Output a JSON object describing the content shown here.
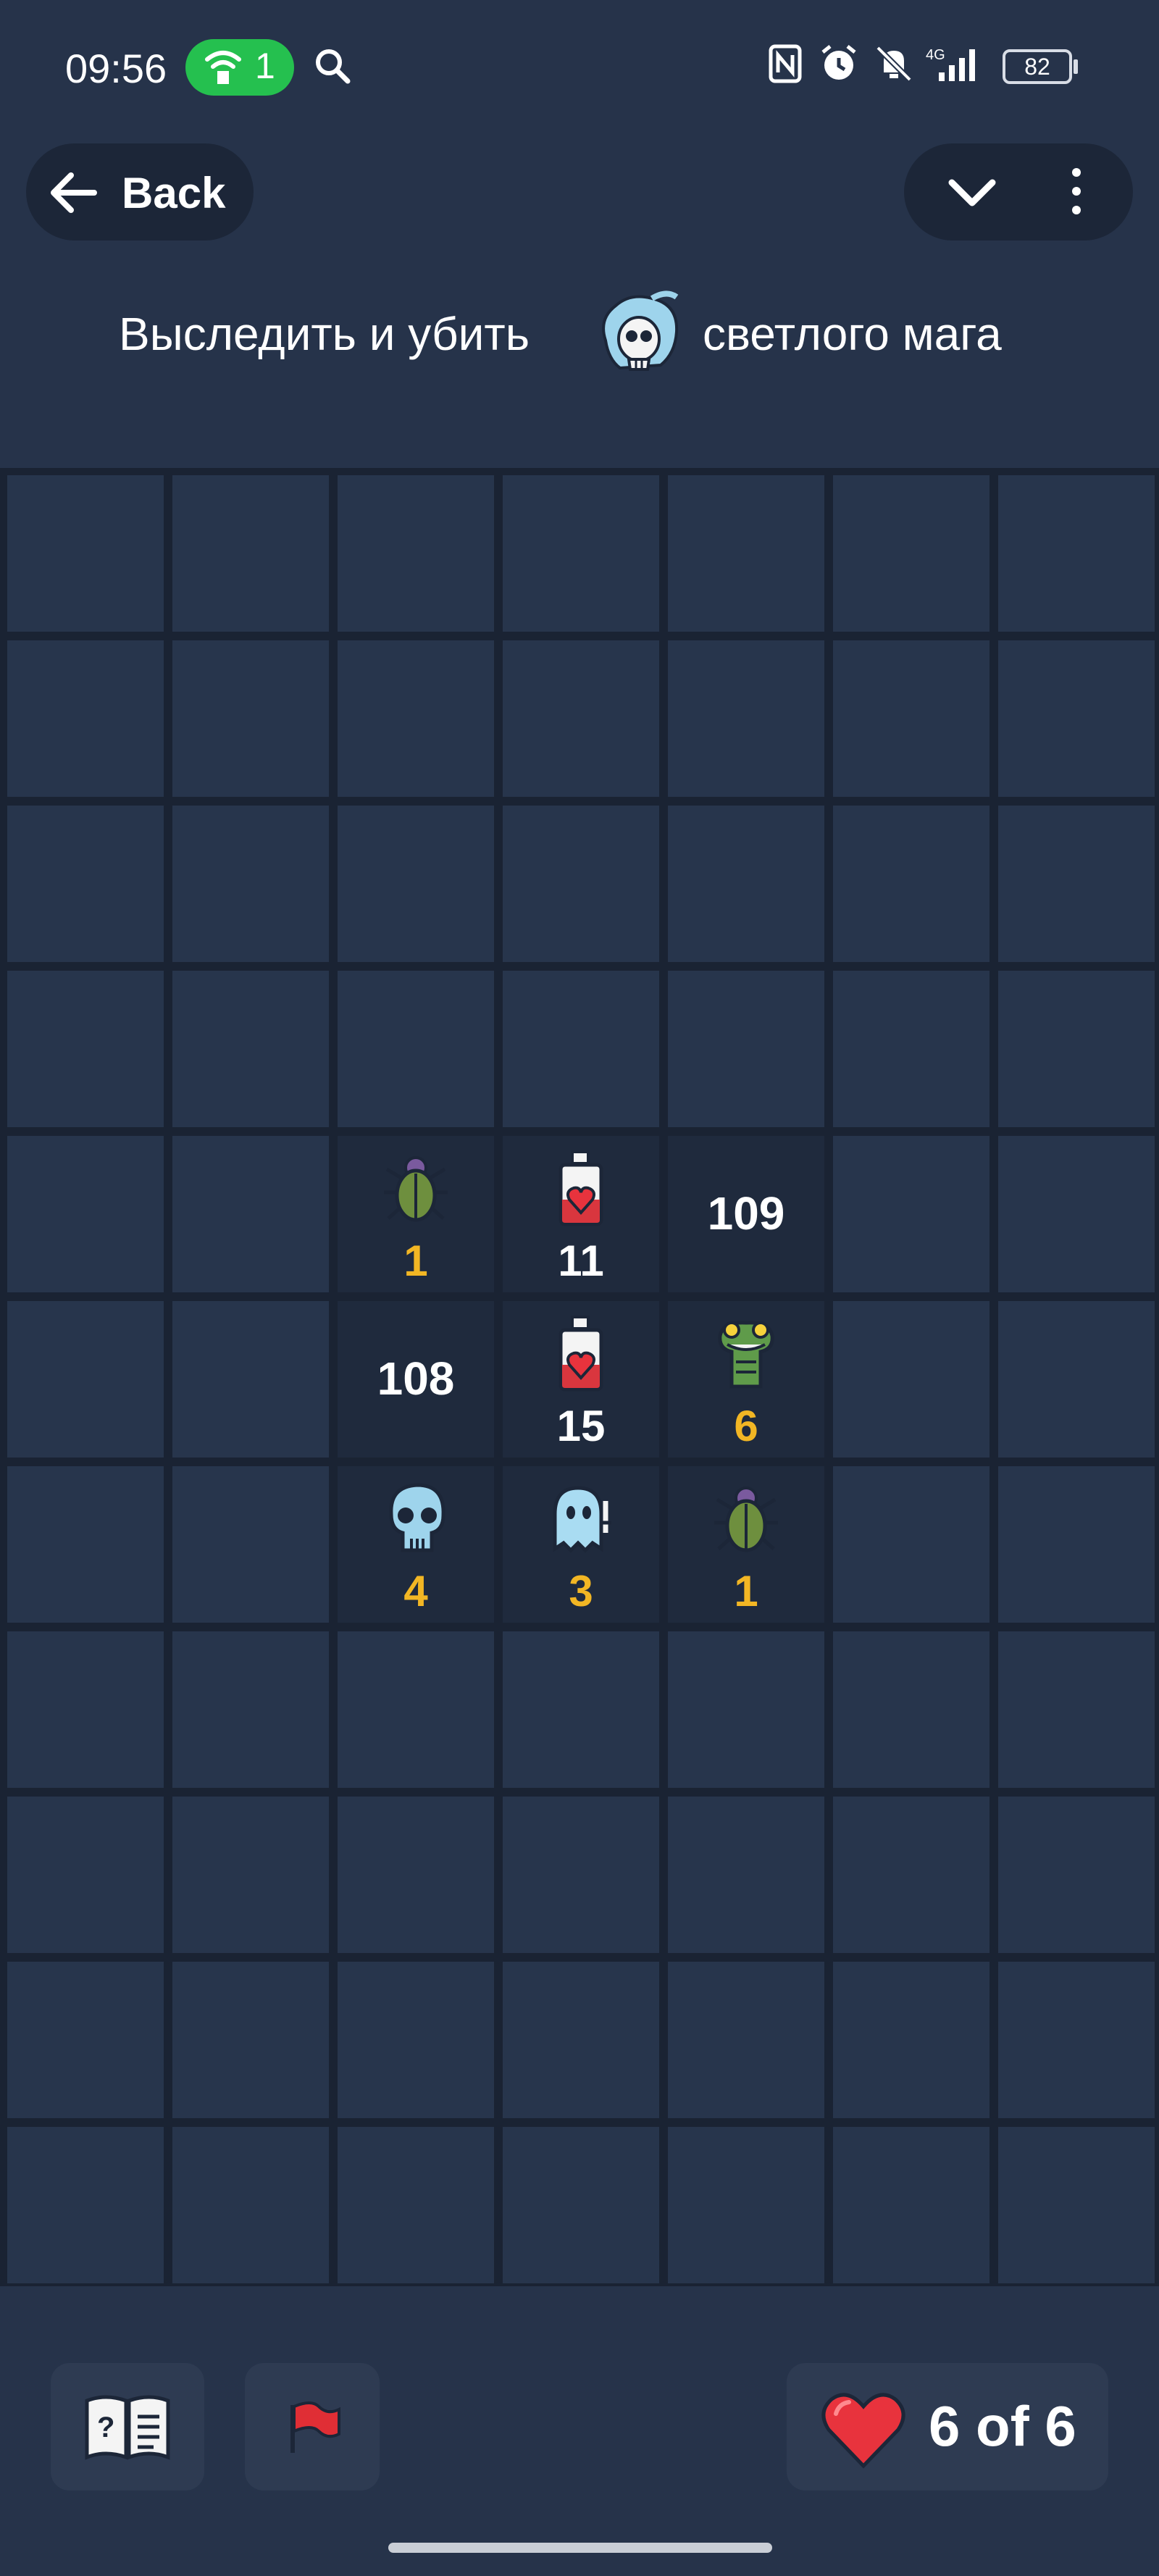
{
  "status_bar": {
    "time": "09:56",
    "hotspot_count": "1",
    "battery_level": "82"
  },
  "header": {
    "back_label": "Back"
  },
  "quest": {
    "text_before": "Выследить и убить",
    "text_after": "светлого мага",
    "target_icon": "ghost-skull-icon"
  },
  "board": {
    "columns": 7,
    "rows": 11,
    "revealed": [
      {
        "row": 4,
        "col": 2,
        "icon": "beetle",
        "value": "1",
        "value_color": "gold"
      },
      {
        "row": 4,
        "col": 3,
        "icon": "health-potion",
        "value": "11",
        "value_color": "white"
      },
      {
        "row": 4,
        "col": 4,
        "icon": "",
        "value": "109",
        "value_color": "white"
      },
      {
        "row": 5,
        "col": 2,
        "icon": "",
        "value": "108",
        "value_color": "white"
      },
      {
        "row": 5,
        "col": 3,
        "icon": "health-potion",
        "value": "15",
        "value_color": "white"
      },
      {
        "row": 5,
        "col": 4,
        "icon": "lizard",
        "value": "6",
        "value_color": "gold"
      },
      {
        "row": 6,
        "col": 2,
        "icon": "skull",
        "value": "4",
        "value_color": "gold"
      },
      {
        "row": 6,
        "col": 3,
        "icon": "ghost",
        "value": "3",
        "value_color": "gold"
      },
      {
        "row": 6,
        "col": 4,
        "icon": "beetle",
        "value": "1",
        "value_color": "gold"
      }
    ]
  },
  "footer": {
    "hp_text": "6 of 6",
    "book_icon": "rulebook-icon",
    "flag_icon": "flag-icon"
  },
  "colors": {
    "background": "#26334a",
    "cell": "#27354c",
    "cell_open": "#1f2a3d",
    "gold": "#f2b624",
    "heart": "#e8333d"
  }
}
